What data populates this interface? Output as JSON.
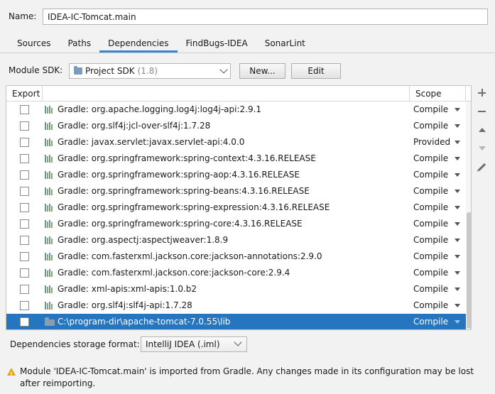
{
  "name": {
    "label": "Name:",
    "value": "IDEA-IC-Tomcat.main"
  },
  "tabs": [
    {
      "label": "Sources",
      "active": false
    },
    {
      "label": "Paths",
      "active": false
    },
    {
      "label": "Dependencies",
      "active": true
    },
    {
      "label": "FindBugs-IDEA",
      "active": false
    },
    {
      "label": "SonarLint",
      "active": false
    }
  ],
  "sdk": {
    "label": "Module SDK:",
    "selected": "Project SDK",
    "version": "(1.8)",
    "new_button": "New...",
    "edit_button": "Edit"
  },
  "table": {
    "headers": {
      "export": "Export",
      "scope": "Scope"
    },
    "rows": [
      {
        "name": "Gradle: org.apache.logging.log4j:log4j-api:2.9.1",
        "scope": "Compile",
        "icon": "library-icon"
      },
      {
        "name": "Gradle: org.slf4j:jcl-over-slf4j:1.7.28",
        "scope": "Compile",
        "icon": "library-icon"
      },
      {
        "name": "Gradle: javax.servlet:javax.servlet-api:4.0.0",
        "scope": "Provided",
        "icon": "library-icon"
      },
      {
        "name": "Gradle: org.springframework:spring-context:4.3.16.RELEASE",
        "scope": "Compile",
        "icon": "library-icon"
      },
      {
        "name": "Gradle: org.springframework:spring-aop:4.3.16.RELEASE",
        "scope": "Compile",
        "icon": "library-icon"
      },
      {
        "name": "Gradle: org.springframework:spring-beans:4.3.16.RELEASE",
        "scope": "Compile",
        "icon": "library-icon"
      },
      {
        "name": "Gradle: org.springframework:spring-expression:4.3.16.RELEASE",
        "scope": "Compile",
        "icon": "library-icon"
      },
      {
        "name": "Gradle: org.springframework:spring-core:4.3.16.RELEASE",
        "scope": "Compile",
        "icon": "library-icon"
      },
      {
        "name": "Gradle: org.aspectj:aspectjweaver:1.8.9",
        "scope": "Compile",
        "icon": "library-icon"
      },
      {
        "name": "Gradle: com.fasterxml.jackson.core:jackson-annotations:2.9.0",
        "scope": "Compile",
        "icon": "library-icon"
      },
      {
        "name": "Gradle: com.fasterxml.jackson.core:jackson-core:2.9.4",
        "scope": "Compile",
        "icon": "library-icon"
      },
      {
        "name": "Gradle: xml-apis:xml-apis:1.0.b2",
        "scope": "Compile",
        "icon": "library-icon"
      },
      {
        "name": "Gradle: org.slf4j:slf4j-api:1.7.28",
        "scope": "Compile",
        "icon": "library-icon"
      },
      {
        "name": "C:\\program-dir\\apache-tomcat-7.0.55\\lib",
        "scope": "Compile",
        "icon": "folder-icon",
        "selected": true
      }
    ]
  },
  "tools": [
    "plus-icon",
    "minus-icon",
    "arrow-up-icon",
    "arrow-down-icon",
    "edit-icon"
  ],
  "storage": {
    "label": "Dependencies storage format:",
    "value": "IntelliJ IDEA (.iml)"
  },
  "warning": "Module 'IDEA-IC-Tomcat.main' is imported from Gradle. Any changes made in its configuration may be lost after reimporting.",
  "colors": {
    "selection": "#2675bf",
    "tab_accent": "#4083c9",
    "warning": "#e4a41c"
  }
}
